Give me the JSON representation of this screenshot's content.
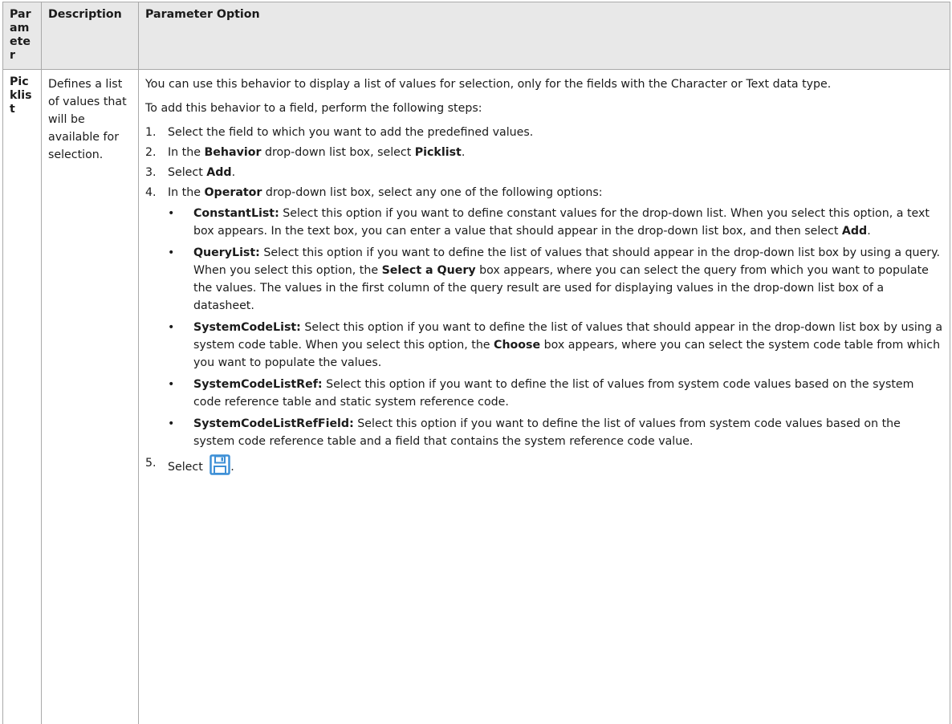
{
  "table": {
    "headers": {
      "parameter": "Parameter",
      "description": "Description",
      "option": "Parameter Option"
    },
    "row": {
      "parameter": "Picklist",
      "description": "Defines a list of values that will be available for selection.",
      "intro": "You can use this behavior to display a list of values for selection, only for the fields with the Character or Text data type.",
      "steps_intro": "To add this behavior to a field, perform the following steps:",
      "steps": [
        {
          "num": "1.",
          "text": "Select the field to which you want to add the predefined values."
        },
        {
          "num": "2.",
          "pre": "In the ",
          "b1": "Behavior",
          "mid": " drop-down list box, select ",
          "b2": "Picklist",
          "post": "."
        },
        {
          "num": "3.",
          "pre": "Select ",
          "b1": "Add",
          "post": "."
        },
        {
          "num": "4.",
          "pre": "In the ",
          "b1": "Operator",
          "post": " drop-down list box, select any one of the following options:"
        },
        {
          "num": "5.",
          "pre": "Select ",
          "post": "."
        }
      ],
      "options": [
        {
          "bullet": "•",
          "name": "ConstantList:",
          "pre": " Select this option if you want to define constant values for the drop-down list. When you select this option, a text box appears. In the text box, you can enter a value that should appear in the drop-down list box, and then select ",
          "b": "Add",
          "post": "."
        },
        {
          "bullet": "•",
          "name": "QueryList:",
          "pre": " Select this option if you want to define the list of values that should appear in the drop-down list box by using a query. When you select this option, the ",
          "b": "Select a Query",
          "post": " box appears, where you can select the query from which you want to populate the values. The values in the first column of the query result are used for displaying values in the drop-down list box of a datasheet."
        },
        {
          "bullet": "•",
          "name": "SystemCodeList:",
          "pre": " Select this option if you want to define the list of values that should appear in the drop-down list box by using a system code table. When you select this option, the ",
          "b": "Choose",
          "post": " box appears, where you can select the system code table from which you want to populate the values."
        },
        {
          "bullet": "•",
          "name": "SystemCodeListRef:",
          "text": " Select this option if you want to define the list of values from system code values based on the system code reference table and static system reference code."
        },
        {
          "bullet": "•",
          "name": "SystemCodeListRefField:",
          "text": " Select this option if you want to define the list of values from system code values based on the system code reference table and a field that contains the system reference code value."
        }
      ]
    }
  },
  "icons": {
    "save": "save-icon"
  },
  "colors": {
    "header_bg": "#e8e8e8",
    "border": "#a9a9a9",
    "icon_blue": "#3d8fd6"
  }
}
